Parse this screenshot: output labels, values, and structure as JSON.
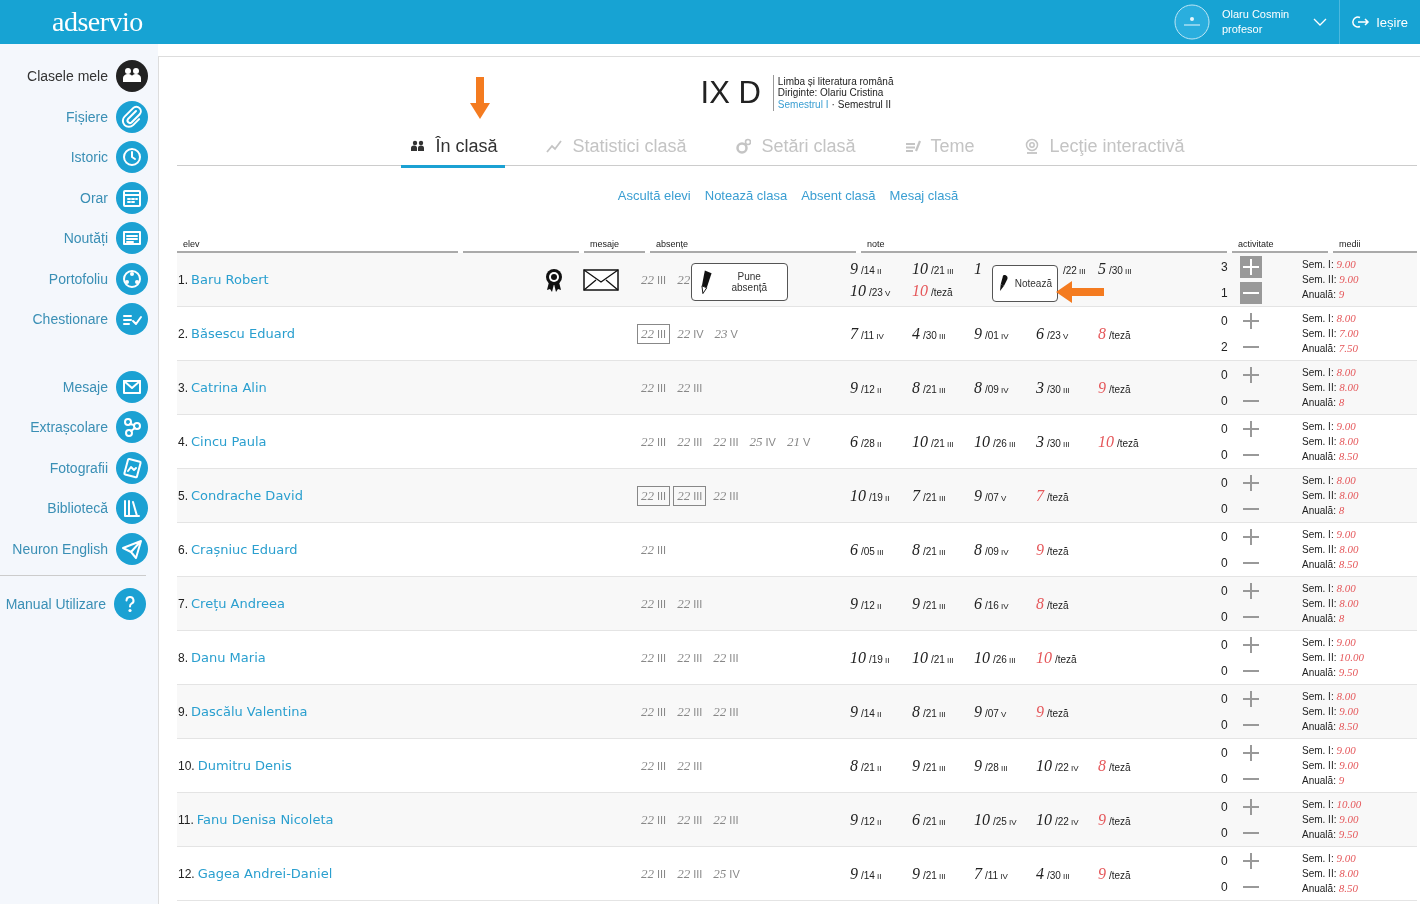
{
  "header": {
    "logo": "adservio",
    "user": {
      "name": "Olaru Cosmin",
      "role": "profesor"
    },
    "logout": "Ieșire"
  },
  "sidebar": {
    "groups": [
      [
        {
          "label": "Clasele mele",
          "selected": true
        },
        {
          "label": "Fișiere",
          "selected": false
        },
        {
          "label": "Istoric",
          "selected": false
        },
        {
          "label": "Orar",
          "selected": false
        },
        {
          "label": "Noutăți",
          "selected": false
        },
        {
          "label": "Portofoliu",
          "selected": false
        },
        {
          "label": "Chestionare",
          "selected": false
        }
      ],
      [
        {
          "label": "Mesaje",
          "selected": false
        },
        {
          "label": "Extrașcolare",
          "selected": false
        },
        {
          "label": "Fotografii",
          "selected": false
        },
        {
          "label": "Bibliotecă",
          "selected": false
        },
        {
          "label": "Neuron English",
          "selected": false
        }
      ],
      [
        {
          "label": "Manual Utilizare",
          "selected": false
        }
      ]
    ]
  },
  "class": {
    "name": "IX D",
    "subject": "Limba și literatura română",
    "head_teacher": "Diriginte: Olariu Cristina",
    "semesters": [
      {
        "label": "Semestrul I",
        "selected": false
      },
      {
        "label": "Semestrul II",
        "selected": true
      }
    ],
    "separator": "·"
  },
  "tabs": [
    {
      "label": "În clasă",
      "selected": true
    },
    {
      "label": "Statistici clasă",
      "selected": false
    },
    {
      "label": "Setări clasă",
      "selected": false
    },
    {
      "label": "Teme",
      "selected": false
    },
    {
      "label": "Lecţie interactivă",
      "selected": false
    }
  ],
  "actions": [
    "Ascultă elevi",
    "Notează clasa",
    "Absent clasă",
    "Mesaj clasă"
  ],
  "table": {
    "columns": [
      "elev",
      "",
      "mesaje",
      "absențe",
      "note",
      "activitate",
      "medii"
    ],
    "rows": [
      {
        "index": "1.",
        "name": "Baru Robert",
        "hovered": true,
        "absences": [
          {
            "day": "22",
            "month": "III",
            "boxed": false
          },
          {
            "day": "22",
            "boxed": false
          }
        ],
        "absence_popup": "Pune absență",
        "grades": [
          {
            "kind": "grade",
            "value": "9",
            "date": "/14",
            "month": "II"
          },
          {
            "kind": "grade",
            "value": "10",
            "date": "/21",
            "month": "III"
          },
          {
            "kind": "grade",
            "value": "1"
          },
          {
            "kind": "grade",
            "date": "/22",
            "month": "III"
          },
          {
            "kind": "grade",
            "value": "5",
            "date": "/30",
            "month": "III"
          },
          {
            "kind": "grade",
            "value": "10",
            "date": "/23",
            "month": "V"
          },
          {
            "kind": "thesis",
            "value": "10",
            "label": "/teză"
          }
        ],
        "grade_popup": "Notează",
        "activity": {
          "plus": "3",
          "minus": "1"
        },
        "averages": [
          {
            "label": "Sem. I:",
            "value": "9.00"
          },
          {
            "label": "Sem. II:",
            "value": "9.00"
          },
          {
            "label": "Anuală:",
            "value": "9"
          }
        ]
      },
      {
        "index": "2.",
        "name": "Băsescu Eduard",
        "hovered": false,
        "absences": [
          {
            "day": "22",
            "month": "III",
            "boxed": true
          },
          {
            "day": "22",
            "month": "IV",
            "boxed": false
          },
          {
            "day": "23",
            "month": "V",
            "boxed": false
          }
        ],
        "grades": [
          {
            "kind": "grade",
            "value": "7",
            "date": "/11",
            "month": "IV"
          },
          {
            "kind": "grade",
            "value": "4",
            "date": "/30",
            "month": "III"
          },
          {
            "kind": "grade",
            "value": "9",
            "date": "/01",
            "month": "IV"
          },
          {
            "kind": "grade",
            "value": "6",
            "date": "/23",
            "month": "V"
          },
          {
            "kind": "thesis",
            "value": "8",
            "label": "/teză"
          }
        ],
        "activity": {
          "plus": "0",
          "minus": "2"
        },
        "averages": [
          {
            "label": "Sem. I:",
            "value": "8.00"
          },
          {
            "label": "Sem. II:",
            "value": "7.00"
          },
          {
            "label": "Anuală:",
            "value": "7.50"
          }
        ]
      },
      {
        "index": "3.",
        "name": "Catrina Alin",
        "hovered": false,
        "absences": [
          {
            "day": "22",
            "month": "III",
            "boxed": false
          },
          {
            "day": "22",
            "month": "III",
            "boxed": false
          }
        ],
        "grades": [
          {
            "kind": "grade",
            "value": "9",
            "date": "/12",
            "month": "II"
          },
          {
            "kind": "grade",
            "value": "8",
            "date": "/21",
            "month": "III"
          },
          {
            "kind": "grade",
            "value": "8",
            "date": "/09",
            "month": "IV"
          },
          {
            "kind": "grade",
            "value": "3",
            "date": "/30",
            "month": "III"
          },
          {
            "kind": "thesis",
            "value": "9",
            "label": "/teză"
          }
        ],
        "activity": {
          "plus": "0",
          "minus": "0"
        },
        "averages": [
          {
            "label": "Sem. I:",
            "value": "8.00"
          },
          {
            "label": "Sem. II:",
            "value": "8.00"
          },
          {
            "label": "Anuală:",
            "value": "8"
          }
        ]
      },
      {
        "index": "4.",
        "name": "Cincu Paula",
        "hovered": false,
        "absences": [
          {
            "day": "22",
            "month": "III",
            "boxed": false
          },
          {
            "day": "22",
            "month": "III",
            "boxed": false
          },
          {
            "day": "22",
            "month": "III",
            "boxed": false
          },
          {
            "day": "25",
            "month": "IV",
            "boxed": false
          },
          {
            "day": "21",
            "month": "V",
            "boxed": false
          }
        ],
        "grades": [
          {
            "kind": "grade",
            "value": "6",
            "date": "/28",
            "month": "II"
          },
          {
            "kind": "grade",
            "value": "10",
            "date": "/21",
            "month": "III"
          },
          {
            "kind": "grade",
            "value": "10",
            "date": "/26",
            "month": "III"
          },
          {
            "kind": "grade",
            "value": "3",
            "date": "/30",
            "month": "III"
          },
          {
            "kind": "thesis",
            "value": "10",
            "label": "/teză"
          }
        ],
        "activity": {
          "plus": "0",
          "minus": "0"
        },
        "averages": [
          {
            "label": "Sem. I:",
            "value": "9.00"
          },
          {
            "label": "Sem. II:",
            "value": "8.00"
          },
          {
            "label": "Anuală:",
            "value": "8.50"
          }
        ]
      },
      {
        "index": "5.",
        "name": "Condrache David",
        "hovered": false,
        "absences": [
          {
            "day": "22",
            "month": "III",
            "boxed": true
          },
          {
            "day": "22",
            "month": "III",
            "boxed": true
          },
          {
            "day": "22",
            "month": "III",
            "boxed": false
          }
        ],
        "grades": [
          {
            "kind": "grade",
            "value": "10",
            "date": "/19",
            "month": "II"
          },
          {
            "kind": "grade",
            "value": "7",
            "date": "/21",
            "month": "III"
          },
          {
            "kind": "grade",
            "value": "9",
            "date": "/07",
            "month": "V"
          },
          {
            "kind": "thesis",
            "value": "7",
            "label": "/teză"
          }
        ],
        "activity": {
          "plus": "0",
          "minus": "0"
        },
        "averages": [
          {
            "label": "Sem. I:",
            "value": "8.00"
          },
          {
            "label": "Sem. II:",
            "value": "8.00"
          },
          {
            "label": "Anuală:",
            "value": "8"
          }
        ]
      },
      {
        "index": "6.",
        "name": "Crașniuc Eduard",
        "hovered": false,
        "absences": [
          {
            "day": "22",
            "month": "III",
            "boxed": false
          }
        ],
        "grades": [
          {
            "kind": "grade",
            "value": "6",
            "date": "/05",
            "month": "III"
          },
          {
            "kind": "grade",
            "value": "8",
            "date": "/21",
            "month": "III"
          },
          {
            "kind": "grade",
            "value": "8",
            "date": "/09",
            "month": "IV"
          },
          {
            "kind": "thesis",
            "value": "9",
            "label": "/teză"
          }
        ],
        "activity": {
          "plus": "0",
          "minus": "0"
        },
        "averages": [
          {
            "label": "Sem. I:",
            "value": "9.00"
          },
          {
            "label": "Sem. II:",
            "value": "8.00"
          },
          {
            "label": "Anuală:",
            "value": "8.50"
          }
        ]
      },
      {
        "index": "7.",
        "name": "Crețu Andreea",
        "hovered": false,
        "absences": [
          {
            "day": "22",
            "month": "III",
            "boxed": false
          },
          {
            "day": "22",
            "month": "III",
            "boxed": false
          }
        ],
        "grades": [
          {
            "kind": "grade",
            "value": "9",
            "date": "/12",
            "month": "II"
          },
          {
            "kind": "grade",
            "value": "9",
            "date": "/21",
            "month": "III"
          },
          {
            "kind": "grade",
            "value": "6",
            "date": "/16",
            "month": "IV"
          },
          {
            "kind": "thesis",
            "value": "8",
            "label": "/teză"
          }
        ],
        "activity": {
          "plus": "0",
          "minus": "0"
        },
        "averages": [
          {
            "label": "Sem. I:",
            "value": "8.00"
          },
          {
            "label": "Sem. II:",
            "value": "8.00"
          },
          {
            "label": "Anuală:",
            "value": "8"
          }
        ]
      },
      {
        "index": "8.",
        "name": "Danu Maria",
        "hovered": false,
        "absences": [
          {
            "day": "22",
            "month": "III",
            "boxed": false
          },
          {
            "day": "22",
            "month": "III",
            "boxed": false
          },
          {
            "day": "22",
            "month": "III",
            "boxed": false
          }
        ],
        "grades": [
          {
            "kind": "grade",
            "value": "10",
            "date": "/19",
            "month": "II"
          },
          {
            "kind": "grade",
            "value": "10",
            "date": "/21",
            "month": "III"
          },
          {
            "kind": "grade",
            "value": "10",
            "date": "/26",
            "month": "III"
          },
          {
            "kind": "thesis",
            "value": "10",
            "label": "/teză"
          }
        ],
        "activity": {
          "plus": "0",
          "minus": "0"
        },
        "averages": [
          {
            "label": "Sem. I:",
            "value": "9.00"
          },
          {
            "label": "Sem. II:",
            "value": "10.00"
          },
          {
            "label": "Anuală:",
            "value": "9.50"
          }
        ]
      },
      {
        "index": "9.",
        "name": "Dascălu Valentina",
        "hovered": false,
        "absences": [
          {
            "day": "22",
            "month": "III",
            "boxed": false
          },
          {
            "day": "22",
            "month": "III",
            "boxed": false
          },
          {
            "day": "22",
            "month": "III",
            "boxed": false
          }
        ],
        "grades": [
          {
            "kind": "grade",
            "value": "9",
            "date": "/14",
            "month": "II"
          },
          {
            "kind": "grade",
            "value": "8",
            "date": "/21",
            "month": "III"
          },
          {
            "kind": "grade",
            "value": "9",
            "date": "/07",
            "month": "V"
          },
          {
            "kind": "thesis",
            "value": "9",
            "label": "/teză"
          }
        ],
        "activity": {
          "plus": "0",
          "minus": "0"
        },
        "averages": [
          {
            "label": "Sem. I:",
            "value": "8.00"
          },
          {
            "label": "Sem. II:",
            "value": "9.00"
          },
          {
            "label": "Anuală:",
            "value": "8.50"
          }
        ]
      },
      {
        "index": "10.",
        "name": "Dumitru Denis",
        "hovered": false,
        "absences": [
          {
            "day": "22",
            "month": "III",
            "boxed": false
          },
          {
            "day": "22",
            "month": "III",
            "boxed": false
          }
        ],
        "grades": [
          {
            "kind": "grade",
            "value": "8",
            "date": "/21",
            "month": "II"
          },
          {
            "kind": "grade",
            "value": "9",
            "date": "/21",
            "month": "III"
          },
          {
            "kind": "grade",
            "value": "9",
            "date": "/28",
            "month": "III"
          },
          {
            "kind": "grade",
            "value": "10",
            "date": "/22",
            "month": "IV"
          },
          {
            "kind": "thesis",
            "value": "8",
            "label": "/teză"
          }
        ],
        "activity": {
          "plus": "0",
          "minus": "0"
        },
        "averages": [
          {
            "label": "Sem. I:",
            "value": "9.00"
          },
          {
            "label": "Sem. II:",
            "value": "9.00"
          },
          {
            "label": "Anuală:",
            "value": "9"
          }
        ]
      },
      {
        "index": "11.",
        "name": "Fanu Denisa Nicoleta",
        "hovered": false,
        "absences": [
          {
            "day": "22",
            "month": "III",
            "boxed": false
          },
          {
            "day": "22",
            "month": "III",
            "boxed": false
          },
          {
            "day": "22",
            "month": "III",
            "boxed": false
          }
        ],
        "grades": [
          {
            "kind": "grade",
            "value": "9",
            "date": "/12",
            "month": "II"
          },
          {
            "kind": "grade",
            "value": "6",
            "date": "/21",
            "month": "III"
          },
          {
            "kind": "grade",
            "value": "10",
            "date": "/25",
            "month": "IV"
          },
          {
            "kind": "grade",
            "value": "10",
            "date": "/22",
            "month": "IV"
          },
          {
            "kind": "thesis",
            "value": "9",
            "label": "/teză"
          }
        ],
        "activity": {
          "plus": "0",
          "minus": "0"
        },
        "averages": [
          {
            "label": "Sem. I:",
            "value": "10.00"
          },
          {
            "label": "Sem. II:",
            "value": "9.00"
          },
          {
            "label": "Anuală:",
            "value": "9.50"
          }
        ]
      },
      {
        "index": "12.",
        "name": "Gagea Andrei-Daniel",
        "hovered": false,
        "absences": [
          {
            "day": "22",
            "month": "III",
            "boxed": false
          },
          {
            "day": "22",
            "month": "III",
            "boxed": false
          },
          {
            "day": "25",
            "month": "IV",
            "boxed": false
          }
        ],
        "grades": [
          {
            "kind": "grade",
            "value": "9",
            "date": "/14",
            "month": "II"
          },
          {
            "kind": "grade",
            "value": "9",
            "date": "/21",
            "month": "III"
          },
          {
            "kind": "grade",
            "value": "7",
            "date": "/11",
            "month": "IV"
          },
          {
            "kind": "grade",
            "value": "4",
            "date": "/30",
            "month": "III"
          },
          {
            "kind": "thesis",
            "value": "9",
            "label": "/teză"
          }
        ],
        "activity": {
          "plus": "0",
          "minus": "0"
        },
        "averages": [
          {
            "label": "Sem. I:",
            "value": "9.00"
          },
          {
            "label": "Sem. II:",
            "value": "8.00"
          },
          {
            "label": "Anuală:",
            "value": "8.50"
          }
        ]
      }
    ]
  }
}
